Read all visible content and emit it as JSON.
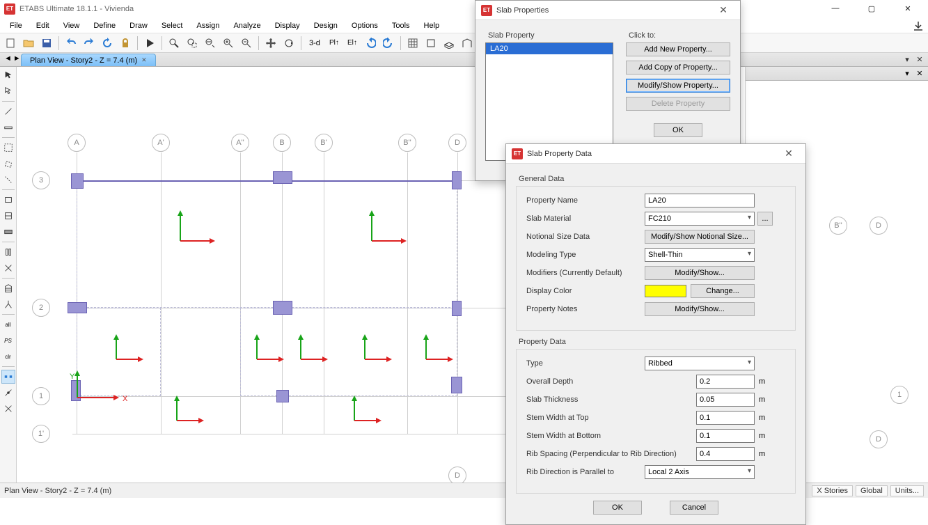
{
  "title": "ETABS Ultimate 18.1.1 - Vivienda",
  "menus": [
    "File",
    "Edit",
    "View",
    "Define",
    "Draw",
    "Select",
    "Assign",
    "Analyze",
    "Display",
    "Design",
    "Options",
    "Tools",
    "Help"
  ],
  "toolbar3d": "3-d",
  "tab_label": "Plan View - Story2 - Z = 7.4 (m)",
  "statusbar_left": "Plan View - Story2 - Z = 7.4 (m)",
  "status_cells": [
    "X Stories",
    "Global",
    "Units..."
  ],
  "grid_cols": {
    "A": "A",
    "Ap": "A'",
    "App": "A''",
    "B": "B",
    "Bp": "B'",
    "Bpp": "B''",
    "D": "D"
  },
  "grid_rows": {
    "r3": "3",
    "r2": "2",
    "r1": "1",
    "r1p": "1'"
  },
  "canvas2_rows": {
    "r1": "1"
  },
  "canvas2_cols": {
    "Bpp": "B''",
    "D": "D",
    "D2": "D"
  },
  "dlg_prop": {
    "title": "Slab Properties",
    "list_label": "Slab Property",
    "click_label": "Click to:",
    "item": "LA20",
    "b_add": "Add New Property...",
    "b_copy": "Add Copy of Property...",
    "b_modify": "Modify/Show Property...",
    "b_delete": "Delete Property",
    "b_ok": "OK"
  },
  "dlg_data": {
    "title": "Slab Property Data",
    "g1": "General Data",
    "g2": "Property Data",
    "l_name": "Property Name",
    "v_name": "LA20",
    "l_mat": "Slab Material",
    "v_mat": "FC210",
    "l_notional": "Notional Size Data",
    "b_notional": "Modify/Show Notional Size...",
    "l_model": "Modeling Type",
    "v_model": "Shell-Thin",
    "l_mods": "Modifiers (Currently Default)",
    "b_mods": "Modify/Show...",
    "l_color": "Display Color",
    "b_color": "Change...",
    "l_notes": "Property Notes",
    "b_notes": "Modify/Show...",
    "l_type": "Type",
    "v_type": "Ribbed",
    "l_depth": "Overall Depth",
    "v_depth": "0.2",
    "u": "m",
    "l_thick": "Slab Thickness",
    "v_thick": "0.05",
    "l_top": "Stem Width at Top",
    "v_top": "0.1",
    "l_bot": "Stem Width at Bottom",
    "v_bot": "0.1",
    "l_spa": "Rib Spacing (Perpendicular to Rib Direction)",
    "v_spa": "0.4",
    "l_dir": "Rib Direction is Parallel to",
    "v_dir": "Local 2 Axis",
    "b_ok": "OK",
    "b_cancel": "Cancel"
  }
}
